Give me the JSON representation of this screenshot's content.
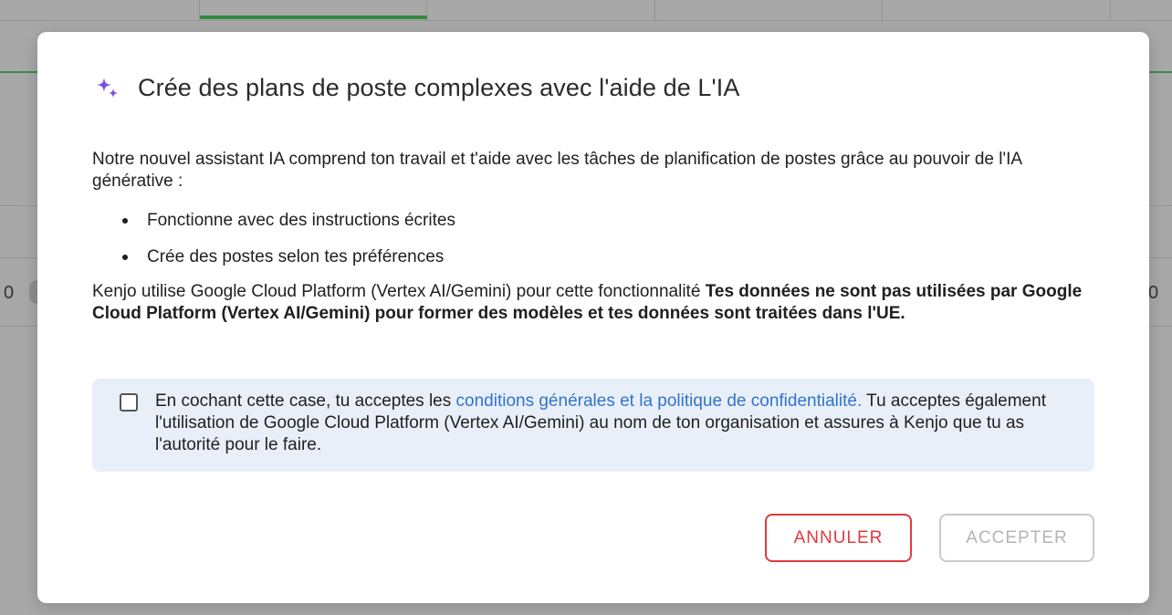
{
  "modal": {
    "title": "Crée des plans de poste complexes avec l'aide de L'IA",
    "title_icon": "sparkle-icon",
    "intro": "Notre nouvel assistant IA comprend ton travail et t'aide avec les tâches de planification de postes grâce au pouvoir de l'IA générative :",
    "bullets": [
      "Fonctionne avec des instructions écrites",
      "Crée des postes selon tes préférences"
    ],
    "info_prefix": "Kenjo utilise Google Cloud Platform (Vertex AI/Gemini) pour cette fonctionnalité ",
    "info_bold": "Tes données ne sont pas utilisées par Google Cloud Platform (Vertex AI/Gemini) pour former des modèles et tes données sont traitées dans l'UE.",
    "consent": {
      "checked": false,
      "text_before": "En cochant cette case, tu acceptes les ",
      "link_text": "conditions générales et la politique de confidentialité.",
      "text_after": " Tu acceptes également l'utilisation de Google Cloud Platform (Vertex AI/Gemini) au nom de ton organisation et assures à Kenjo que tu as l'autorité pour le faire."
    },
    "buttons": {
      "cancel_label": "ANNULER",
      "accept_label": "ACCEPTER"
    }
  },
  "background": {
    "left_number": "0",
    "right_number": "0"
  },
  "colors": {
    "accent_purple": "#7b4fe0",
    "link_blue": "#2f74cf",
    "cancel_red": "#e03a3e",
    "disabled_gray": "#b4b4b4",
    "consent_bg": "#e9eff9"
  }
}
